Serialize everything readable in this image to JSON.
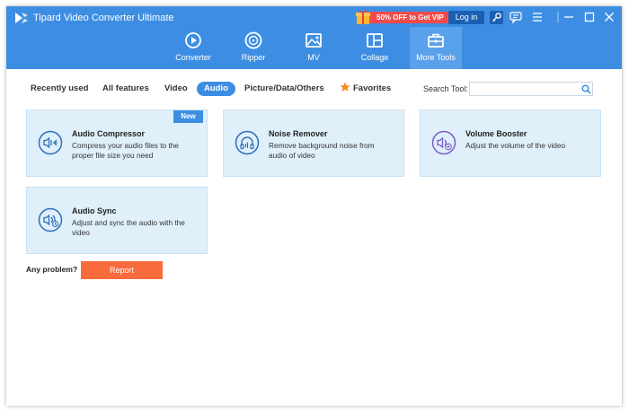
{
  "app": {
    "title": "Tipard Video Converter Ultimate"
  },
  "header": {
    "promo_text": "50% OFF to Get VIP",
    "login_label": "Log in"
  },
  "nav": [
    {
      "label": "Converter",
      "icon": "converter-icon"
    },
    {
      "label": "Ripper",
      "icon": "ripper-icon"
    },
    {
      "label": "MV",
      "icon": "mv-icon"
    },
    {
      "label": "Collage",
      "icon": "collage-icon"
    },
    {
      "label": "More Tools",
      "icon": "toolbox-icon",
      "active": true
    }
  ],
  "filters": {
    "tabs": [
      "Recently used",
      "All features",
      "Video",
      "Audio",
      "Picture/Data/Others",
      "Favorites"
    ],
    "active": "Audio"
  },
  "search": {
    "label": "Search Tool:",
    "value": ""
  },
  "tools": [
    {
      "title": "Audio Compressor",
      "description": "Compress your audio files to the proper file size you need",
      "badge": "New",
      "icon": "audio-compressor-icon"
    },
    {
      "title": "Noise Remover",
      "description": "Remove background noise from audio of video",
      "icon": "noise-remover-icon"
    },
    {
      "title": "Volume Booster",
      "description": "Adjust the volume of the video",
      "icon": "volume-booster-icon"
    },
    {
      "title": "Audio Sync",
      "description": "Adjust and sync the audio with the video",
      "icon": "audio-sync-icon"
    }
  ],
  "footer": {
    "problem_label": "Any problem?",
    "report_label": "Report"
  },
  "colors": {
    "header": "#3d8ee3",
    "card": "#e0f0fb",
    "report": "#f76b3c",
    "promo": "#f24a4a"
  }
}
